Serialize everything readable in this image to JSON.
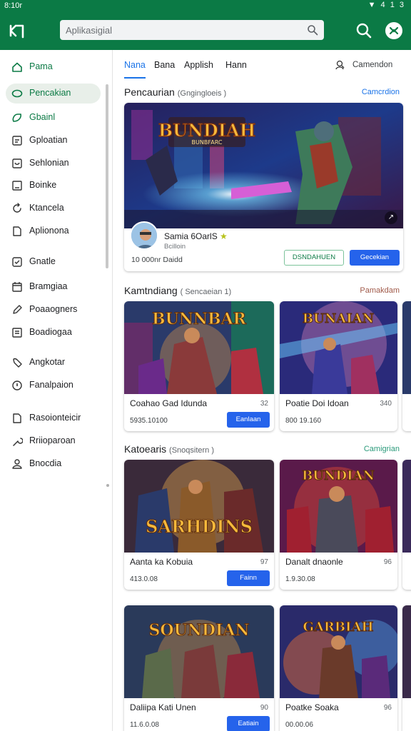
{
  "status": {
    "time": "8:10r",
    "icons": "▼ 4 1 3"
  },
  "header": {
    "search_placeholder": "Aplikasigial"
  },
  "sidebar": {
    "items": [
      {
        "label": "Pama",
        "icon": "home-icon"
      },
      {
        "label": "Pencakian",
        "icon": "search-icon"
      },
      {
        "label": "Gbainl",
        "icon": "game-icon"
      },
      {
        "label": "Gploatian",
        "icon": "grid-icon"
      },
      {
        "label": "Sehlonian",
        "icon": "chat-icon"
      },
      {
        "label": "Boinke",
        "icon": "book-icon"
      },
      {
        "label": "Ktancela",
        "icon": "refresh-icon"
      },
      {
        "label": "Aplionona",
        "icon": "app-icon"
      },
      {
        "label": "Gnatle",
        "icon": "check-icon"
      },
      {
        "label": "Bramgiaa",
        "icon": "calendar-icon"
      },
      {
        "label": "Poaaogners",
        "icon": "edit-icon"
      },
      {
        "label": "Boadiogaa",
        "icon": "folder-icon"
      },
      {
        "label": "Angkotar",
        "icon": "tag-icon"
      },
      {
        "label": "Fanalpaion",
        "icon": "info-icon"
      },
      {
        "label": "Rasoionteicir",
        "icon": "file-icon"
      },
      {
        "label": "Rriioparoan",
        "icon": "wrench-icon"
      },
      {
        "label": "Bnocdia",
        "icon": "person-icon"
      }
    ]
  },
  "tabs": [
    "Nana",
    "Bana",
    "Applish",
    "Hann"
  ],
  "account_label": "Camendon",
  "section1": {
    "title": "Pencaurian",
    "subtitle": "(Gngingloeis )",
    "link": "Camcrdion"
  },
  "featured": {
    "art_title": "BUNDIAH",
    "art_subtitle": "BUNBFARC",
    "name": "Samia 6OarlS",
    "star": "★",
    "developer": "Bcilloin",
    "meta": "10 000nr Daidd",
    "btn_outline": "DSNDAHUEN",
    "btn_solid": "Gecekian",
    "badge": "↗"
  },
  "section2": {
    "title": "Kamtndiang",
    "subtitle": "( Sencaeian 1)",
    "link": "Pamakdam"
  },
  "row1": [
    {
      "art_title": "BUNNBAR",
      "title": "Coahao Gad Idunda",
      "rating": "32",
      "price": "5935.10100",
      "button": "Eanlaan"
    },
    {
      "art_title": "BUNAIAN",
      "title": "Poatie Doi Idoan",
      "rating": "340",
      "price": "800 19.160",
      "button": ""
    }
  ],
  "section3": {
    "title": "Katoearis",
    "subtitle": "(Snoqsitern )",
    "link": "Camigrian"
  },
  "row2": [
    {
      "art_title": "SARHDINS",
      "title": "Aanta ka Kobuia",
      "rating": "97",
      "price": "413.0.08",
      "button": "Fainn"
    },
    {
      "art_title": "BUNDIAN",
      "title": "Danalt dnaonle",
      "rating": "96",
      "price": "1.9.30.08",
      "button": ""
    }
  ],
  "row3": [
    {
      "art_title": "SOUNDIAN",
      "title": "Daliipa Kati Unen",
      "rating": "90",
      "price": "11.6.0.08",
      "button": "Eatiain"
    },
    {
      "art_title": "GARBIAH",
      "title": "Poatke Soaka",
      "rating": "96",
      "price": "00.00.06",
      "button": ""
    }
  ]
}
